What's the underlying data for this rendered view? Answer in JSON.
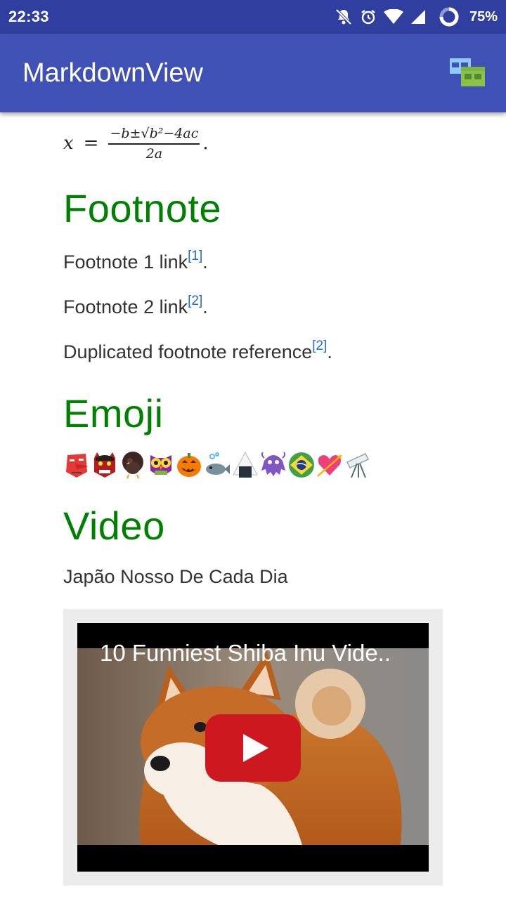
{
  "status_bar": {
    "time": "22:33",
    "battery": "75%",
    "icons": [
      "vibrate-off-icon",
      "alarm-icon",
      "wifi-icon",
      "cell-signal-icon",
      "battery-ring-icon"
    ]
  },
  "app_bar": {
    "title": "MarkdownView",
    "action_icon": "windows-icon"
  },
  "content": {
    "math": {
      "variable": "x",
      "equals": "=",
      "numerator": "−b±√b²−4ac",
      "denominator": "2a",
      "period": "."
    },
    "footnote_section": {
      "heading": "Footnote",
      "lines": [
        {
          "text": "Footnote 1 link",
          "ref": "[1]",
          "after": "."
        },
        {
          "text": "Footnote 2 link",
          "ref": "[2]",
          "after": "."
        },
        {
          "text": "Duplicated footnote reference",
          "ref": "[2]",
          "after": "."
        }
      ]
    },
    "emoji_section": {
      "heading": "Emoji",
      "emojis": [
        "tengu-mask",
        "oni-mask",
        "turkey",
        "owl",
        "jack-o-lantern",
        "fish",
        "rice-ball",
        "alien-monster",
        "brazil-flag",
        "heart-with-arrow",
        "telescope"
      ]
    },
    "video_section": {
      "heading": "Video",
      "caption": "Japão Nosso De Cada Dia",
      "video_title": "10 Funniest Shiba Inu Vide..",
      "play_icon": "youtube-play-icon"
    }
  },
  "colors": {
    "status_bar": "#303f9f",
    "app_bar": "#3f51b5",
    "heading": "#008000",
    "link": "#1e6fc8",
    "youtube_red": "#cc181e"
  }
}
